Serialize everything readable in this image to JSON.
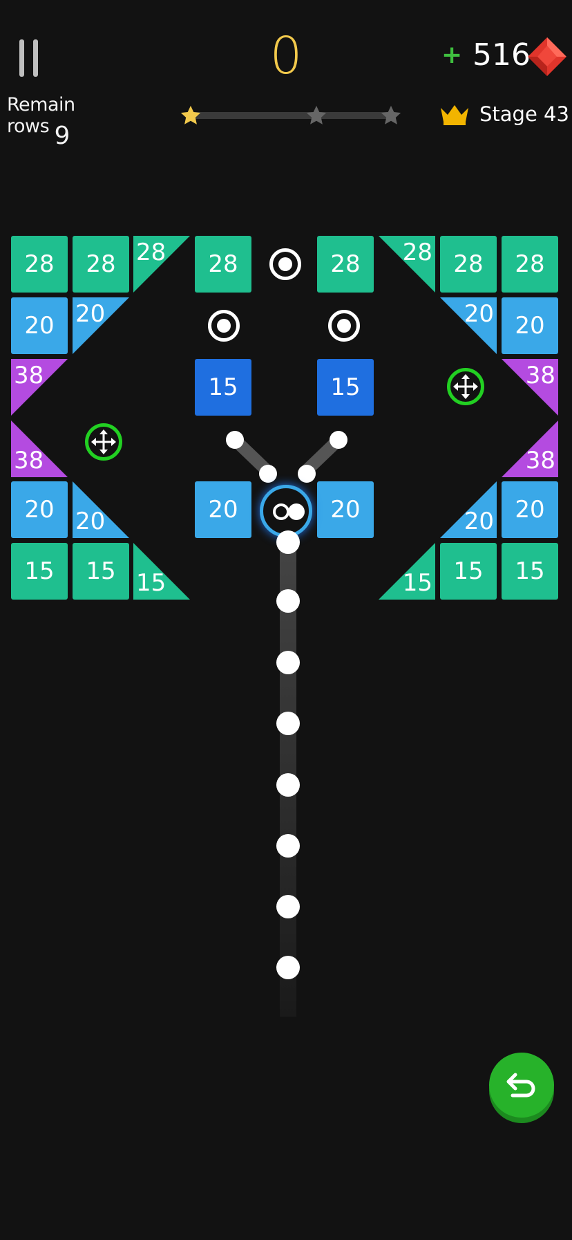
{
  "hud": {
    "remain_label": "Remain rows",
    "remain_value": "9",
    "score": "0",
    "gem_plus": "+",
    "gems": "516",
    "stage": "Stage 43",
    "stars_earned": 1,
    "stars_total": 3
  },
  "blocks": {
    "r1": [
      "28",
      "28",
      "28",
      "28",
      "28",
      "28",
      "28",
      "28"
    ],
    "r2": [
      "20",
      "20",
      "20",
      "20"
    ],
    "r3": [
      "38",
      "15",
      "15",
      "38"
    ],
    "r4": [
      "38",
      "38"
    ],
    "r5": [
      "20",
      "20",
      "20",
      "20",
      "20",
      "20"
    ],
    "r6": [
      "15",
      "15",
      "15",
      "15",
      "15",
      "15"
    ]
  },
  "colors": {
    "teal": "#1fbf8f",
    "sky": "#3aa8e8",
    "purple": "#b44be0",
    "royal": "#1f6fe0",
    "gold": "#f2c94c",
    "green": "#27b22a",
    "gem": "#e0352b"
  }
}
